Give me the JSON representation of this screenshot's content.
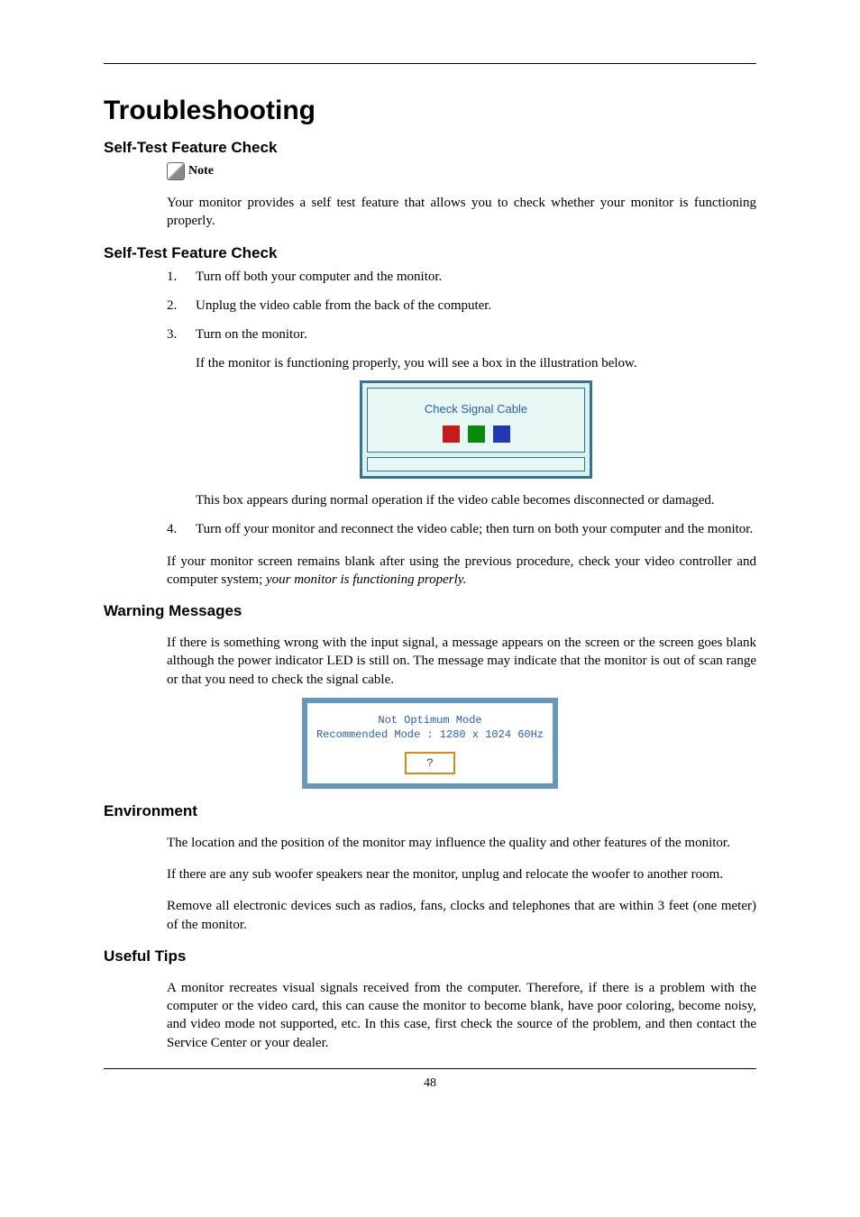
{
  "page": {
    "title": "Troubleshooting",
    "number": "48"
  },
  "sections": {
    "selfTestHeading1": "Self-Test Feature Check",
    "noteLabel": "Note",
    "noteBody": "Your monitor provides a self test feature that allows you to check whether your monitor is functioning properly.",
    "selfTestHeading2": "Self-Test Feature Check",
    "steps": {
      "s1": "Turn off both your computer and the monitor.",
      "s2": "Unplug the video cable from the back of the computer.",
      "s3": "Turn on the monitor.",
      "s3b": "If the monitor is functioning properly, you will see a box in the illustration below.",
      "s3c": "This box appears during normal operation if the video cable becomes disconnected or damaged.",
      "s4": "Turn off your monitor and reconnect the video cable; then turn on both your computer and the monitor."
    },
    "afterSteps1": "If your monitor screen remains blank after using the previous procedure, check your video controller and computer system; ",
    "afterSteps1Italic": "your monitor is functioning properly.",
    "warningHeading": "Warning Messages",
    "warningBody": "If there is something wrong with the input signal, a message appears on the screen or the screen goes blank although the power indicator LED is still on. The message may indicate that the monitor is out of scan range or that you need to check the signal cable.",
    "envHeading": "Environment",
    "envP1": "The location and the position of the monitor may influence the quality and other features of the monitor.",
    "envP2": "If there are any sub woofer speakers near the monitor, unplug and relocate the woofer to another room.",
    "envP3": "Remove all electronic devices such as radios, fans, clocks and telephones that are within 3 feet (one meter) of the monitor.",
    "tipsHeading": "Useful Tips",
    "tipsP1": "A monitor recreates visual signals received from the computer. Therefore, if there is a problem with the computer or the video card, this can cause the monitor to become blank, have poor coloring, become noisy, and video mode not supported, etc. In this case, first check the source of the problem, and then contact the Service Center or your dealer."
  },
  "figures": {
    "checkSignal": {
      "text": "Check Signal Cable"
    },
    "notOptimum": {
      "line1": "Not Optimum Mode",
      "line2": "Recommended Mode : 1280 x 1024  60Hz",
      "button": "?"
    }
  }
}
